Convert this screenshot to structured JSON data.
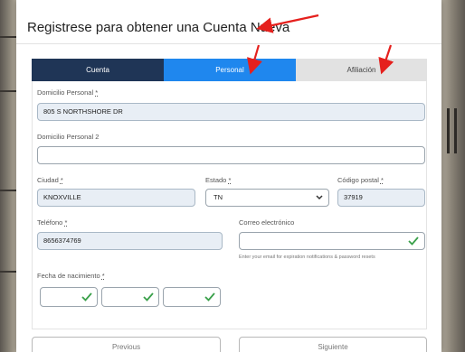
{
  "modal": {
    "title": "Registrese para obtener una Cuenta Nueva"
  },
  "tabs": [
    {
      "label": "Cuenta"
    },
    {
      "label": "Personal"
    },
    {
      "label": "Afiliación"
    }
  ],
  "form": {
    "address1_label": "Domicilio Personal",
    "required_mark": "*",
    "address1_value": "805 S NORTHSHORE DR",
    "address2_label": "Domicilio Personal 2",
    "address2_value": "",
    "city_label": "Ciudad",
    "city_value": "KNOXVILLE",
    "state_label": "Estado",
    "state_value": "TN",
    "zip_label": "Código postal",
    "zip_value": "37919",
    "phone_label": "Teléfono",
    "phone_value": "8656374769",
    "email_label": "Correo electrónico",
    "email_value": "",
    "email_hint": "Enter your email for expiration notifications & password resets",
    "dob_label": "Fecha de nacimiento"
  },
  "footer": {
    "previous_label": "Previous",
    "next_label": "Siguiente"
  },
  "colors": {
    "tab_account": "#1f3556",
    "tab_personal_active": "#1f87ee",
    "tab_affiliation": "#e2e2e2",
    "check_green": "#3aa04a",
    "annotation_arrow": "#e5201d"
  },
  "icons": [
    "chevron-down-icon",
    "check-icon",
    "red-arrow-annotation"
  ]
}
